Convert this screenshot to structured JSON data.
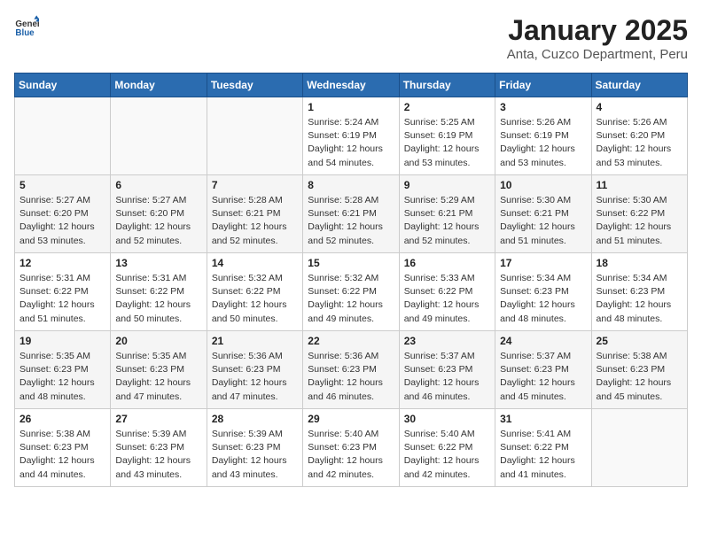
{
  "logo": {
    "text_general": "General",
    "text_blue": "Blue",
    "tagline": "GeneralBlue"
  },
  "title": "January 2025",
  "subtitle": "Anta, Cuzco Department, Peru",
  "days_of_week": [
    "Sunday",
    "Monday",
    "Tuesday",
    "Wednesday",
    "Thursday",
    "Friday",
    "Saturday"
  ],
  "weeks": [
    [
      {
        "day": "",
        "info": ""
      },
      {
        "day": "",
        "info": ""
      },
      {
        "day": "",
        "info": ""
      },
      {
        "day": "1",
        "info": "Sunrise: 5:24 AM\nSunset: 6:19 PM\nDaylight: 12 hours\nand 54 minutes."
      },
      {
        "day": "2",
        "info": "Sunrise: 5:25 AM\nSunset: 6:19 PM\nDaylight: 12 hours\nand 53 minutes."
      },
      {
        "day": "3",
        "info": "Sunrise: 5:26 AM\nSunset: 6:19 PM\nDaylight: 12 hours\nand 53 minutes."
      },
      {
        "day": "4",
        "info": "Sunrise: 5:26 AM\nSunset: 6:20 PM\nDaylight: 12 hours\nand 53 minutes."
      }
    ],
    [
      {
        "day": "5",
        "info": "Sunrise: 5:27 AM\nSunset: 6:20 PM\nDaylight: 12 hours\nand 53 minutes."
      },
      {
        "day": "6",
        "info": "Sunrise: 5:27 AM\nSunset: 6:20 PM\nDaylight: 12 hours\nand 52 minutes."
      },
      {
        "day": "7",
        "info": "Sunrise: 5:28 AM\nSunset: 6:21 PM\nDaylight: 12 hours\nand 52 minutes."
      },
      {
        "day": "8",
        "info": "Sunrise: 5:28 AM\nSunset: 6:21 PM\nDaylight: 12 hours\nand 52 minutes."
      },
      {
        "day": "9",
        "info": "Sunrise: 5:29 AM\nSunset: 6:21 PM\nDaylight: 12 hours\nand 52 minutes."
      },
      {
        "day": "10",
        "info": "Sunrise: 5:30 AM\nSunset: 6:21 PM\nDaylight: 12 hours\nand 51 minutes."
      },
      {
        "day": "11",
        "info": "Sunrise: 5:30 AM\nSunset: 6:22 PM\nDaylight: 12 hours\nand 51 minutes."
      }
    ],
    [
      {
        "day": "12",
        "info": "Sunrise: 5:31 AM\nSunset: 6:22 PM\nDaylight: 12 hours\nand 51 minutes."
      },
      {
        "day": "13",
        "info": "Sunrise: 5:31 AM\nSunset: 6:22 PM\nDaylight: 12 hours\nand 50 minutes."
      },
      {
        "day": "14",
        "info": "Sunrise: 5:32 AM\nSunset: 6:22 PM\nDaylight: 12 hours\nand 50 minutes."
      },
      {
        "day": "15",
        "info": "Sunrise: 5:32 AM\nSunset: 6:22 PM\nDaylight: 12 hours\nand 49 minutes."
      },
      {
        "day": "16",
        "info": "Sunrise: 5:33 AM\nSunset: 6:22 PM\nDaylight: 12 hours\nand 49 minutes."
      },
      {
        "day": "17",
        "info": "Sunrise: 5:34 AM\nSunset: 6:23 PM\nDaylight: 12 hours\nand 48 minutes."
      },
      {
        "day": "18",
        "info": "Sunrise: 5:34 AM\nSunset: 6:23 PM\nDaylight: 12 hours\nand 48 minutes."
      }
    ],
    [
      {
        "day": "19",
        "info": "Sunrise: 5:35 AM\nSunset: 6:23 PM\nDaylight: 12 hours\nand 48 minutes."
      },
      {
        "day": "20",
        "info": "Sunrise: 5:35 AM\nSunset: 6:23 PM\nDaylight: 12 hours\nand 47 minutes."
      },
      {
        "day": "21",
        "info": "Sunrise: 5:36 AM\nSunset: 6:23 PM\nDaylight: 12 hours\nand 47 minutes."
      },
      {
        "day": "22",
        "info": "Sunrise: 5:36 AM\nSunset: 6:23 PM\nDaylight: 12 hours\nand 46 minutes."
      },
      {
        "day": "23",
        "info": "Sunrise: 5:37 AM\nSunset: 6:23 PM\nDaylight: 12 hours\nand 46 minutes."
      },
      {
        "day": "24",
        "info": "Sunrise: 5:37 AM\nSunset: 6:23 PM\nDaylight: 12 hours\nand 45 minutes."
      },
      {
        "day": "25",
        "info": "Sunrise: 5:38 AM\nSunset: 6:23 PM\nDaylight: 12 hours\nand 45 minutes."
      }
    ],
    [
      {
        "day": "26",
        "info": "Sunrise: 5:38 AM\nSunset: 6:23 PM\nDaylight: 12 hours\nand 44 minutes."
      },
      {
        "day": "27",
        "info": "Sunrise: 5:39 AM\nSunset: 6:23 PM\nDaylight: 12 hours\nand 43 minutes."
      },
      {
        "day": "28",
        "info": "Sunrise: 5:39 AM\nSunset: 6:23 PM\nDaylight: 12 hours\nand 43 minutes."
      },
      {
        "day": "29",
        "info": "Sunrise: 5:40 AM\nSunset: 6:23 PM\nDaylight: 12 hours\nand 42 minutes."
      },
      {
        "day": "30",
        "info": "Sunrise: 5:40 AM\nSunset: 6:22 PM\nDaylight: 12 hours\nand 42 minutes."
      },
      {
        "day": "31",
        "info": "Sunrise: 5:41 AM\nSunset: 6:22 PM\nDaylight: 12 hours\nand 41 minutes."
      },
      {
        "day": "",
        "info": ""
      }
    ]
  ]
}
